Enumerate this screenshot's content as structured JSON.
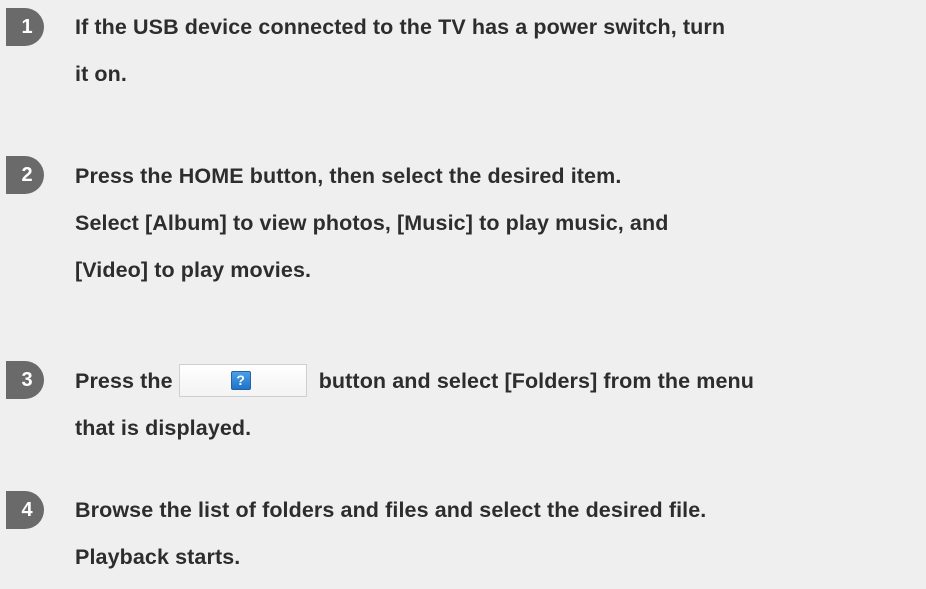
{
  "steps": [
    {
      "number": "1",
      "lines": [
        "If the USB device connected to the TV has a power switch, turn",
        "it on."
      ]
    },
    {
      "number": "2",
      "lines": [
        "Press the HOME button, then select the desired item.",
        "Select [Album] to view photos, [Music] to play music, and",
        "[Video] to play movies."
      ]
    },
    {
      "number": "3",
      "lines": [
        "Press the",
        "button and select [Folders] from the menu",
        "that is displayed."
      ],
      "button_icon": "help-icon",
      "button_icon_glyph": "?"
    },
    {
      "number": "4",
      "lines": [
        "Browse the list of folders and files and select the desired file.",
        "Playback starts."
      ]
    }
  ]
}
